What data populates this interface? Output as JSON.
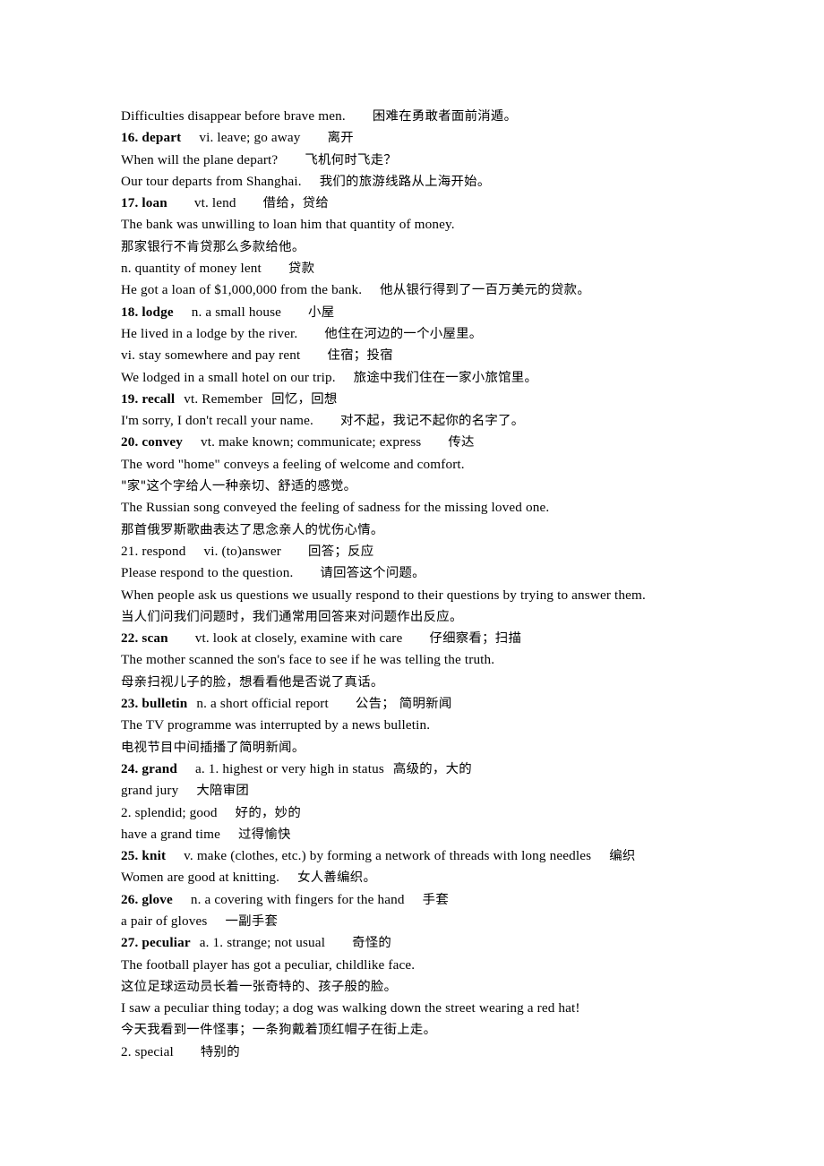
{
  "document": {
    "type": "vocabulary-study-notes",
    "language_pair": "English-Chinese",
    "entry_range": "16-27"
  },
  "lines": [
    {
      "id": "line-difficulties",
      "kind": "example",
      "english": "Difficulties disappear before brave men.",
      "gap": 3,
      "chinese": "困难在勇敢者面前消遁。"
    },
    {
      "id": "entry-16-depart",
      "kind": "headword",
      "bold": true,
      "headword": "16. depart",
      "gap_a": 2,
      "definition": "vi. leave; go away",
      "gap_b": 3,
      "chinese": "离开"
    },
    {
      "id": "line-depart-ex1",
      "kind": "example",
      "english": "When will the plane depart?",
      "gap": 3,
      "chinese": "飞机何时飞走？"
    },
    {
      "id": "line-depart-ex2",
      "kind": "example",
      "english": "Our tour departs from Shanghai.",
      "gap": 2,
      "chinese": "我们的旅游线路从上海开始。"
    },
    {
      "id": "entry-17-loan",
      "kind": "headword",
      "bold": true,
      "headword": "17. loan",
      "gap_a": 3,
      "definition": "vt. lend",
      "gap_b": 3,
      "chinese": "借给，贷给"
    },
    {
      "id": "line-loan-ex1-en",
      "kind": "example",
      "english": "The bank was unwilling to loan him that quantity of money.",
      "gap": 0,
      "chinese": ""
    },
    {
      "id": "line-loan-ex1-zh",
      "kind": "example",
      "english": "",
      "gap": 0,
      "chinese": "那家银行不肯贷那么多款给他。"
    },
    {
      "id": "line-loan-sense2",
      "kind": "sense",
      "english": "n. quantity of money lent",
      "gap": 3,
      "chinese": "贷款"
    },
    {
      "id": "line-loan-ex2",
      "kind": "example",
      "english": "He got a loan of $1,000,000 from the bank.",
      "gap": 2,
      "chinese": "他从银行得到了一百万美元的贷款。"
    },
    {
      "id": "entry-18-lodge",
      "kind": "headword",
      "bold": true,
      "headword": "18. lodge",
      "gap_a": 2,
      "definition": "n. a small house",
      "gap_b": 3,
      "chinese": "小屋"
    },
    {
      "id": "line-lodge-ex1",
      "kind": "example",
      "english": "He lived in a lodge by the river.",
      "gap": 3,
      "chinese": "他住在河边的一个小屋里。"
    },
    {
      "id": "line-lodge-sense2",
      "kind": "sense",
      "english": "vi. stay somewhere and pay rent",
      "gap": 3,
      "chinese": "住宿；投宿"
    },
    {
      "id": "line-lodge-ex2",
      "kind": "example",
      "english": "We lodged in a small hotel on our trip.",
      "gap": 2,
      "chinese": "旅途中我们住在一家小旅馆里。"
    },
    {
      "id": "entry-19-recall",
      "kind": "headword",
      "bold": true,
      "headword": "19. recall",
      "gap_a": 1,
      "definition": "vt. Remember",
      "gap_b": 1,
      "chinese": "回忆，回想"
    },
    {
      "id": "line-recall-ex1",
      "kind": "example",
      "english": "I'm sorry, I don't recall your name.",
      "gap": 3,
      "chinese": "对不起，我记不起你的名字了。"
    },
    {
      "id": "entry-20-convey",
      "kind": "headword",
      "bold": true,
      "headword": "20. convey",
      "gap_a": 2,
      "definition": "vt. make known; communicate; express",
      "gap_b": 3,
      "chinese": "传达"
    },
    {
      "id": "line-convey-ex1-en",
      "kind": "example",
      "english": "The word \"home\" conveys a feeling of welcome and comfort.",
      "gap": 0,
      "chinese": ""
    },
    {
      "id": "line-convey-ex1-zh",
      "kind": "example",
      "english": "",
      "gap": 0,
      "chinese": "\"家\"这个字给人一种亲切、舒适的感觉。"
    },
    {
      "id": "line-convey-ex2-en",
      "kind": "example",
      "english": "The Russian song conveyed the feeling of sadness for the missing loved one.",
      "gap": 0,
      "chinese": ""
    },
    {
      "id": "line-convey-ex2-zh",
      "kind": "example",
      "english": "",
      "gap": 0,
      "chinese": "那首俄罗斯歌曲表达了思念亲人的忧伤心情。"
    },
    {
      "id": "entry-21-respond",
      "kind": "headword",
      "bold": false,
      "headword": "21. respond",
      "gap_a": 2,
      "definition": "vi. (to)answer",
      "gap_b": 3,
      "chinese": "回答；反应"
    },
    {
      "id": "line-respond-ex1",
      "kind": "example",
      "english": "Please respond to the question.",
      "gap": 3,
      "chinese": "请回答这个问题。"
    },
    {
      "id": "line-respond-ex2-en",
      "kind": "example",
      "english": "When people ask us questions we usually respond to their questions by trying to answer them.",
      "gap": 0,
      "chinese": ""
    },
    {
      "id": "line-respond-ex2-zh",
      "kind": "example",
      "english": "",
      "gap": 0,
      "chinese": "当人们问我们问题时，我们通常用回答来对问题作出反应。"
    },
    {
      "id": "entry-22-scan",
      "kind": "headword",
      "bold": true,
      "headword": "22. scan",
      "gap_a": 3,
      "definition": "vt. look at closely, examine with care",
      "gap_b": 3,
      "chinese": "仔细察看；扫描"
    },
    {
      "id": "line-scan-ex1-en",
      "kind": "example",
      "english": "The mother scanned the son's face to see if he was telling the truth.",
      "gap": 0,
      "chinese": ""
    },
    {
      "id": "line-scan-ex1-zh",
      "kind": "example",
      "english": "",
      "gap": 0,
      "chinese": "母亲扫视儿子的脸，想看看他是否说了真话。"
    },
    {
      "id": "entry-23-bulletin",
      "kind": "headword",
      "bold": true,
      "headword": "23. bulletin",
      "gap_a": 1,
      "definition": "n. a short official report",
      "gap_b": 3,
      "chinese": "公告； 简明新闻"
    },
    {
      "id": "line-bulletin-ex1-en",
      "kind": "example",
      "english": "The TV programme was interrupted by a news bulletin.",
      "gap": 0,
      "chinese": ""
    },
    {
      "id": "line-bulletin-ex1-zh",
      "kind": "example",
      "english": "",
      "gap": 0,
      "chinese": "电视节目中间插播了简明新闻。"
    },
    {
      "id": "entry-24-grand",
      "kind": "headword",
      "bold": true,
      "headword": "24. grand",
      "gap_a": 2,
      "definition": "a. 1. highest or very high in status",
      "gap_b": 1,
      "chinese": "高级的，大的"
    },
    {
      "id": "line-grand-phrase1",
      "kind": "phrase",
      "english": "grand jury",
      "gap": 2,
      "chinese": "大陪审团"
    },
    {
      "id": "line-grand-sense2",
      "kind": "sense",
      "english": "2. splendid; good",
      "gap": 2,
      "chinese": "好的，妙的"
    },
    {
      "id": "line-grand-phrase2",
      "kind": "phrase",
      "english": "have a grand time",
      "gap": 2,
      "chinese": "过得愉快"
    },
    {
      "id": "entry-25-knit",
      "kind": "headword",
      "bold": true,
      "headword": "25. knit",
      "gap_a": 2,
      "definition": "v. make (clothes, etc.) by forming a network of threads with long needles",
      "gap_b": 2,
      "chinese": "编织"
    },
    {
      "id": "line-knit-ex1",
      "kind": "example",
      "english": "Women are good at knitting.",
      "gap": 2,
      "chinese": "女人善编织。"
    },
    {
      "id": "entry-26-glove",
      "kind": "headword",
      "bold": true,
      "headword": "26. glove",
      "gap_a": 2,
      "definition": "n. a covering with fingers for the hand",
      "gap_b": 2,
      "chinese": "手套"
    },
    {
      "id": "line-glove-phrase1",
      "kind": "phrase",
      "english": "a pair of gloves",
      "gap": 2,
      "chinese": "一副手套"
    },
    {
      "id": "entry-27-peculiar",
      "kind": "headword",
      "bold": true,
      "headword": "27. peculiar",
      "gap_a": 1,
      "definition": "a. 1. strange; not usual",
      "gap_b": 3,
      "chinese": "奇怪的"
    },
    {
      "id": "line-peculiar-ex1-en",
      "kind": "example",
      "english": "The football player has got a peculiar, childlike face.",
      "gap": 0,
      "chinese": ""
    },
    {
      "id": "line-peculiar-ex1-zh",
      "kind": "example",
      "english": "",
      "gap": 0,
      "chinese": "这位足球运动员长着一张奇特的、孩子般的脸。"
    },
    {
      "id": "line-peculiar-ex2-en",
      "kind": "example",
      "english": "I saw a peculiar thing today; a dog was walking down the street wearing a red hat!",
      "gap": 0,
      "chinese": ""
    },
    {
      "id": "line-peculiar-ex2-zh",
      "kind": "example",
      "english": "",
      "gap": 0,
      "chinese": "今天我看到一件怪事；一条狗戴着顶红帽子在街上走。"
    },
    {
      "id": "line-peculiar-sense2",
      "kind": "sense",
      "english": "2. special",
      "gap": 3,
      "chinese": "特别的"
    }
  ]
}
